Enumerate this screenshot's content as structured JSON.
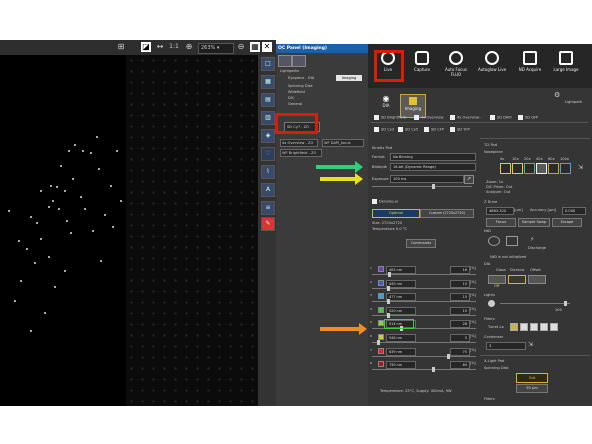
{
  "toolbar": {
    "zoom": "263%",
    "scale": "1:1"
  },
  "mid": {
    "title": "OC Panel (Imaging)",
    "lightpaths": "Lightpaths",
    "eyepiece": "Eyepiece - DIA",
    "imaging": "Imaging",
    "spinning": "Spinning Disk",
    "widefield": "Widefield",
    "dic": "DIC",
    "general": "General",
    "sd": "SD Cy7 - ZO",
    "ov": "4x Overview - ZO",
    "dapi": "WF DAPI_focus",
    "bf": "WF Brightfield - ZO"
  },
  "top": {
    "live": "Live",
    "capture": "Capture",
    "autofocus": "Auto Focus FLUO",
    "autoglow": "Autoglow Live",
    "nd": "ND Acquire",
    "large": "Large Image"
  },
  "tabs": {
    "dia": "DIA",
    "imaging": "Imaging",
    "lightpath": "Lightpath"
  },
  "presets": [
    "SD Brightfield",
    "4x Overview",
    "4x Overview -",
    "SD DAPI",
    "SD GFP",
    "SD Cy3",
    "SD Cy5",
    "SD CFP",
    "SD YFP"
  ],
  "kinetix": {
    "title": "Kinetix Pad",
    "format_label": "Format",
    "format": "No Binning",
    "bitdepth_label": "Bitdepth",
    "bitdepth": "16-bit (Dynamic Range)",
    "exposure_label": "Exposure",
    "exposure": "100 ms",
    "denoise": "Denoise.ai",
    "optimal": "Optimal",
    "custom": "Custom (2720x2720)",
    "size": "Size: 2720x2720",
    "temp": "Temperature 0.0 °C",
    "commands": "Commands"
  },
  "lasers": [
    {
      "n": "1",
      "wl": "405 nm",
      "power": "16",
      "color": "#6a3fd0"
    },
    {
      "n": "2",
      "wl": "445 nm",
      "power": "15",
      "color": "#3a5ee0"
    },
    {
      "n": "3",
      "wl": "477 nm",
      "power": "15",
      "color": "#2aa7e8"
    },
    {
      "n": "4",
      "wl": "520 nm",
      "power": "15",
      "color": "#3ccf3c"
    },
    {
      "n": "5",
      "wl": "514 nm",
      "power": "28",
      "color": "#7adf2a"
    },
    {
      "n": "6",
      "wl": "546 nm",
      "power": "5",
      "color": "#c8d420"
    },
    {
      "n": "7",
      "wl": "639 nm",
      "power": "75",
      "color": "#e02424"
    },
    {
      "n": "8",
      "wl": "730 nm",
      "power": "60",
      "color": "#b01818"
    }
  ],
  "laser_footer": "Temperature: 25°C, Supply: 400mA, 9W",
  "ti2": {
    "title": "Ti2 Pad",
    "nosepiece": "Nosepiece",
    "objs": [
      "4x",
      "10x",
      "20x",
      "40x",
      "60x",
      "100x"
    ],
    "zoom": "Zoom: 1x",
    "dicprism": "DIC Prism: Out",
    "analyzer": "Analyzer: Out",
    "zdrive": "Z Drive",
    "zval": "4863.320",
    "zunit": "[µm]",
    "acc_label": "Accuracy [µm]",
    "acc": "0.000",
    "focus": "Focus",
    "sample": "Sample Swap",
    "escape": "Escape",
    "ntf": "NtD",
    "status": "NtD is not initialized",
    "discharge": "Discharge",
    "dia": "DIA",
    "glass": "Glass",
    "dichroic": "Dichroic",
    "offset": "Offset",
    "off": "Off",
    "lights": "Lights",
    "lightval": "100",
    "filters": "Filters",
    "turret": "Turret-Lo",
    "condenser": "Condenser",
    "cond_val": "3"
  },
  "xlight": {
    "title": "X-Light Pad",
    "disk": "Spinning Disk",
    "out": "Out",
    "pinhole": "50 µm",
    "filters": "Filters"
  }
}
